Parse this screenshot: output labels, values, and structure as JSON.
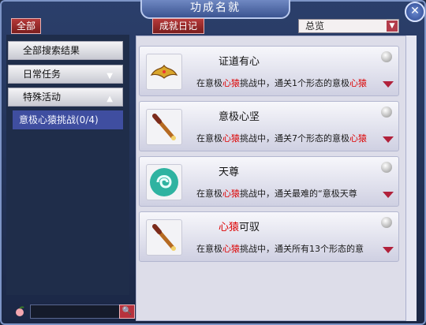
{
  "window": {
    "title": "功成名就"
  },
  "toolbar": {
    "all_label": "全部",
    "diary_label": "成就日记"
  },
  "dropdown": {
    "selected": "总览"
  },
  "categories": {
    "items": [
      {
        "label": "全部搜索结果"
      },
      {
        "label": "日常任务"
      },
      {
        "label": "特殊活动"
      }
    ],
    "selected_sub": "意极心猿挑战(0/4)"
  },
  "achievements": [
    {
      "title_a": "证道有心",
      "title_hl": "",
      "title_b": "",
      "desc_a": "在意极",
      "desc_hl": "心猿",
      "desc_b": "挑战中，通关1个形态的意极",
      "desc_hl2": "心猿"
    },
    {
      "title_a": "意极心坚",
      "title_hl": "",
      "title_b": "",
      "desc_a": "在意极",
      "desc_hl": "心猿",
      "desc_b": "挑战中，通关7个形态的意极",
      "desc_hl2": "心猿"
    },
    {
      "title_a": "天尊",
      "title_hl": "",
      "title_b": "",
      "desc_a": "在意极",
      "desc_hl": "心猿",
      "desc_b": "挑战中，通关最难的“意极天尊",
      "desc_hl2": ""
    },
    {
      "title_a": "",
      "title_hl": "心猿",
      "title_b": "可驭",
      "desc_a": "在意极",
      "desc_hl": "心猿",
      "desc_b": "挑战中，通关所有13个形态的意",
      "desc_hl2": ""
    }
  ],
  "colors": {
    "accent_red": "#d00000",
    "panel_bg": "#dddde9"
  }
}
